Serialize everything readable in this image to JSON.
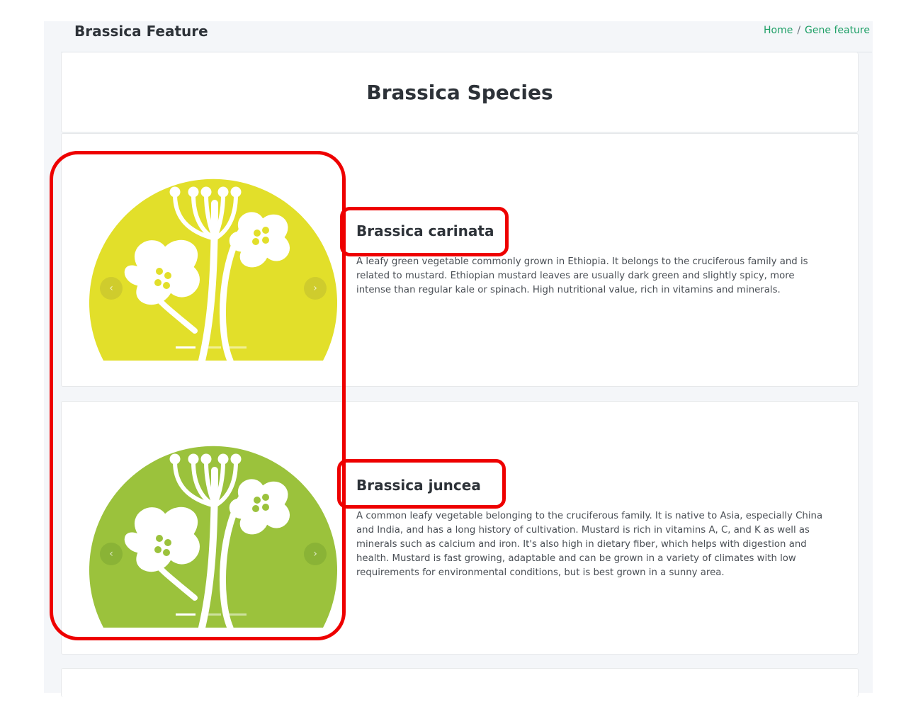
{
  "topbar": {
    "title": "Brassica Feature",
    "breadcrumb": {
      "home": "Home",
      "separator": "/",
      "current": "Gene feature"
    }
  },
  "page": {
    "title": "Brassica Species"
  },
  "species": [
    {
      "name": "Brassica carinata",
      "description": "A leafy green vegetable commonly grown in Ethiopia. It belongs to the cruciferous family and is related to mustard. Ethiopian mustard leaves are usually dark green and slightly spicy, more intense than regular kale or spinach. High nutritional value, rich in vitamins and minerals.",
      "color": "#e2df2a",
      "prev_icon": "‹",
      "next_icon": "›"
    },
    {
      "name": "Brassica juncea",
      "description": "A common leafy vegetable belonging to the cruciferous family. It is native to Asia, especially China and India, and has a long history of cultivation. Mustard is rich in vitamins A, C, and K as well as minerals such as calcium and iron. It's also high in dietary fiber, which helps with digestion and health. Mustard is fast growing, adaptable and can be grown in a variety of climates with low requirements for environmental conditions, but is best grown in a sunny area.",
      "color": "#9bc23c",
      "prev_icon": "‹",
      "next_icon": "›"
    }
  ],
  "colors": {
    "accent_link": "#1fa067",
    "highlight": "#ee0000",
    "page_background": "#f4f6f9"
  }
}
